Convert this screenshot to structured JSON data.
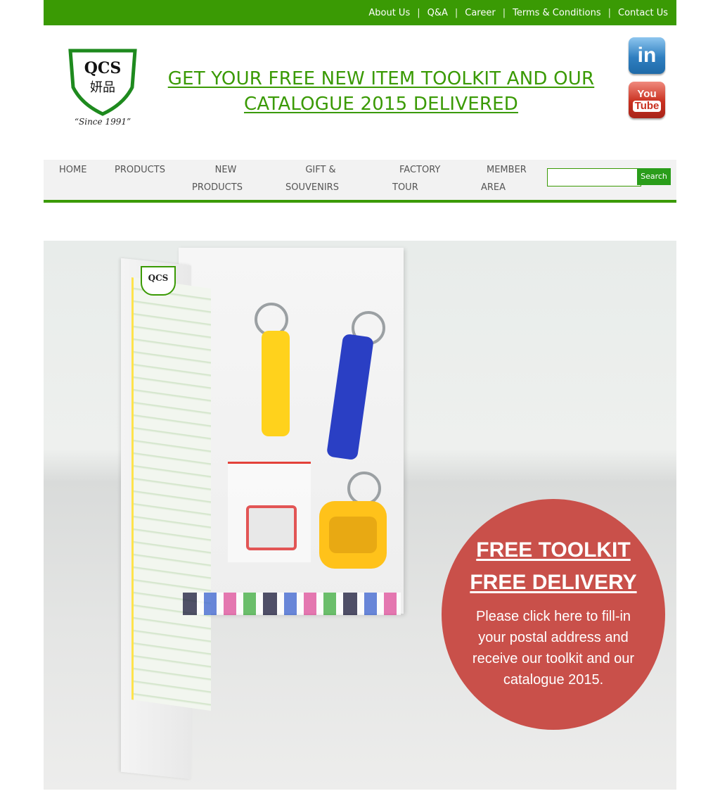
{
  "top_links": [
    "About Us",
    "Q&A",
    "Career",
    "Terms & Conditions",
    "Contact Us"
  ],
  "logo": {
    "brand": "QCS",
    "chinese": "妍品",
    "since": "“Since 1991”"
  },
  "headline": {
    "line1": "GET YOUR FREE NEW ITEM TOOLKIT AND OUR",
    "line2": "CATALOGUE 2015 DELIVERED"
  },
  "social": {
    "linkedin": "in",
    "youtube_top": "You",
    "youtube_bottom": "Tube"
  },
  "nav": [
    {
      "line1": "HOME",
      "line2": ""
    },
    {
      "line1": "PRODUCTS",
      "line2": ""
    },
    {
      "line1": "NEW",
      "line2": "PRODUCTS"
    },
    {
      "line1": "GIFT &",
      "line2": "SOUVENIRS"
    },
    {
      "line1": "FACTORY",
      "line2": "TOUR"
    },
    {
      "line1": "MEMBER",
      "line2": "AREA"
    }
  ],
  "search": {
    "placeholder": "",
    "button": "Search"
  },
  "banner": {
    "circle_title1": "FREE TOOLKIT",
    "circle_title2": "FREE DELIVERY",
    "circle_body": "Please click here to fill-in your postal address and receive our toolkit and our catalogue 2015.",
    "circle_color": "#c9504a"
  },
  "colors": {
    "brand_green": "#3a9a04"
  }
}
